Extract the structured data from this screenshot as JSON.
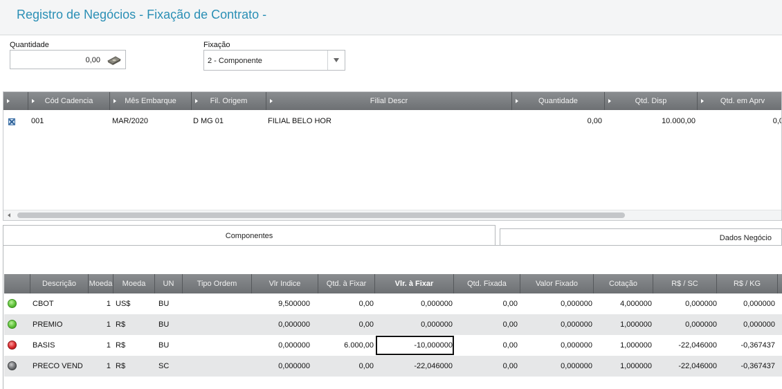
{
  "window": {
    "title": "Registro de Negócios - Fixação de Contrato -"
  },
  "form": {
    "quantidade_label": "Quantidade",
    "quantidade_value": "0,00",
    "fixacao_label": "Fixação",
    "fixacao_value": "2 - Componente"
  },
  "cadencia_grid": {
    "columns": [
      "",
      "Cód Cadencia",
      "Mês Embarque",
      "Fil. Origem",
      "Filial Descr",
      "Quantidade",
      "Qtd. Disp",
      "Qtd. em Aprv"
    ],
    "rows": [
      {
        "codigo": "001",
        "mes": "MAR/2020",
        "origem": "D MG 01",
        "descr": "FILIAL BELO HOR",
        "quantidade": "0,00",
        "disp": "10.000,00",
        "aprv": "0,0"
      }
    ]
  },
  "tabs": {
    "componentes": "Componentes",
    "dados_negocio": "Dados Negócio"
  },
  "componentes_grid": {
    "columns": [
      "",
      "Descrição",
      "Moeda",
      "Moeda",
      "UN",
      "Tipo Ordem",
      "Vlr Indice",
      "Qtd. à Fixar",
      "Vlr. à Fixar",
      "Qtd. Fixada",
      "Valor Fixado",
      "Cotação",
      "R$ / SC",
      "R$ / KG"
    ],
    "rows": [
      {
        "status": "green",
        "descricao": "CBOT",
        "moeda_cod": "1",
        "moeda": "US$",
        "un": "BU",
        "tipo": "",
        "vlr_indice": "9,500000",
        "qtd_fixar": "0,00",
        "vlr_fixar": "0,000000",
        "qtd_fixada": "0,00",
        "valor_fixado": "0,000000",
        "cotacao": "4,000000",
        "rs_sc": "0,000000",
        "rs_kg": "0,000000"
      },
      {
        "status": "green",
        "descricao": "PREMIO",
        "moeda_cod": "1",
        "moeda": "R$",
        "un": "BU",
        "tipo": "",
        "vlr_indice": "0,000000",
        "qtd_fixar": "0,00",
        "vlr_fixar": "0,000000",
        "qtd_fixada": "0,00",
        "valor_fixado": "0,000000",
        "cotacao": "1,000000",
        "rs_sc": "0,000000",
        "rs_kg": "0,000000"
      },
      {
        "status": "red",
        "descricao": "BASIS",
        "moeda_cod": "1",
        "moeda": "R$",
        "un": "BU",
        "tipo": "",
        "vlr_indice": "0,000000",
        "qtd_fixar": "6.000,00",
        "vlr_fixar": "-10,000000",
        "qtd_fixada": "0,00",
        "valor_fixado": "0,000000",
        "cotacao": "1,000000",
        "rs_sc": "-22,046000",
        "rs_kg": "-0,367437"
      },
      {
        "status": "gray",
        "descricao": "PRECO VEND",
        "moeda_cod": "1",
        "moeda": "R$",
        "un": "SC",
        "tipo": "",
        "vlr_indice": "0,000000",
        "qtd_fixar": "0,00",
        "vlr_fixar": "-22,046000",
        "qtd_fixada": "0,00",
        "valor_fixado": "0,000000",
        "cotacao": "1,000000",
        "rs_sc": "-22,046000",
        "rs_kg": "-0,367437"
      }
    ]
  },
  "colors": {
    "accent": "#2a8fb5",
    "led_green": "#5fc13a",
    "led_red": "#d8282c",
    "led_gray": "#6e7073"
  },
  "icons": {
    "quantidade_field": "money-icon",
    "fixacao_dropdown": "chevron-down-icon",
    "row_select": "checkbox-icon"
  }
}
